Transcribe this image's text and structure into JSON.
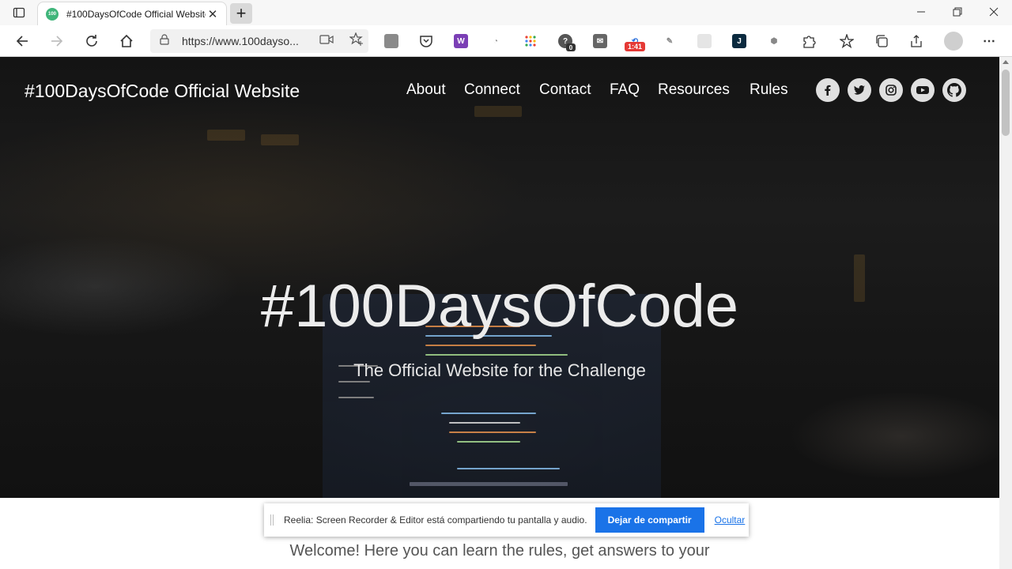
{
  "browser": {
    "tab": {
      "favicon_text": "100",
      "title": "#100DaysOfCode Official Website"
    },
    "address_bar": {
      "url": "https://www.100dayso..."
    },
    "extensions": [
      {
        "name": "extension-badge-icon",
        "badge": "0"
      },
      {
        "name": "clock-extension-icon",
        "badge": "1:41"
      },
      {
        "name": "j-extension-icon",
        "badge": "J"
      }
    ]
  },
  "site": {
    "title": "#100DaysOfCode Official Website",
    "nav": [
      "About",
      "Connect",
      "Contact",
      "FAQ",
      "Resources",
      "Rules"
    ],
    "social": [
      "facebook-icon",
      "twitter-icon",
      "instagram-icon",
      "youtube-icon",
      "github-icon"
    ]
  },
  "hero": {
    "title": "#100DaysOfCode",
    "subtitle": "The Official Website for the Challenge"
  },
  "welcome_text": "Welcome! Here you can learn the rules, get answers to your",
  "share_notification": {
    "message": "Reelia: Screen Recorder & Editor está compartiendo tu pantalla y audio.",
    "stop_label": "Dejar de compartir",
    "hide_label": "Ocultar"
  }
}
